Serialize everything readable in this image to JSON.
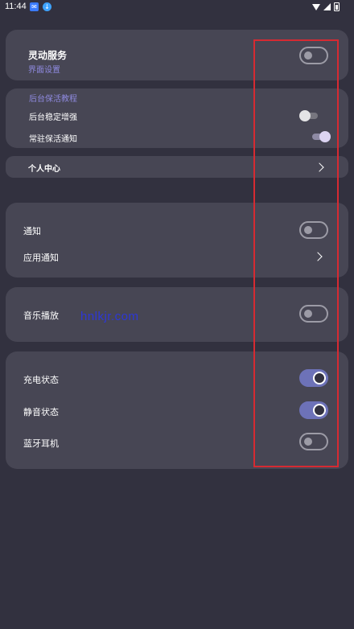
{
  "status_bar": {
    "time": "11:44",
    "app_badges": [
      "mail-badge-icon",
      "download-badge-icon"
    ],
    "icons": [
      "wifi-icon",
      "signal-icon",
      "battery-icon"
    ]
  },
  "card_service": {
    "title": "灵动服务",
    "subtitle": "界面设置",
    "toggle_on": false
  },
  "card_background": {
    "header": "后台保活教程",
    "items": [
      {
        "label": "后台稳定增强",
        "toggle_on": false
      },
      {
        "label": "常驻保活通知",
        "toggle_on": true
      }
    ]
  },
  "personal_center": {
    "label": "个人中心"
  },
  "card_notify": {
    "items": [
      {
        "label": "通知",
        "toggle_on": false
      },
      {
        "label": "应用通知"
      }
    ]
  },
  "card_music": {
    "label": "音乐播放",
    "toggle_on": false,
    "watermark": "hnlkjr.com"
  },
  "card_state": {
    "items": [
      {
        "label": "充电状态",
        "toggle_on": true
      },
      {
        "label": "静音状态",
        "toggle_on": true
      },
      {
        "label": "蓝牙耳机",
        "toggle_on": false
      }
    ]
  },
  "colors": {
    "background": "#32313f",
    "card": "#474654",
    "accent": "#6d72b8",
    "highlight_box": "#d62a32"
  }
}
